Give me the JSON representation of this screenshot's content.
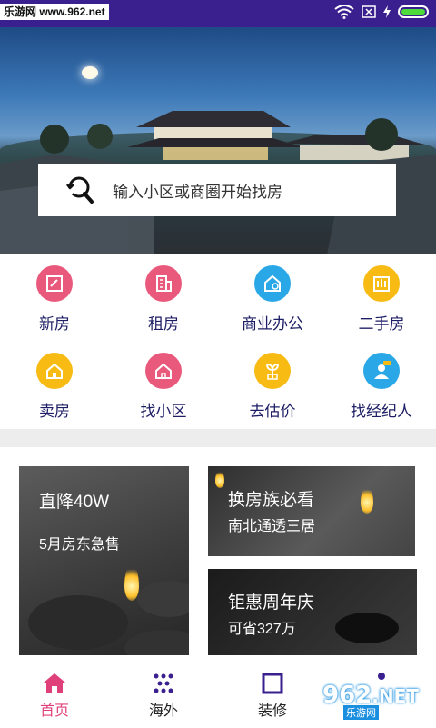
{
  "status_bar": {
    "watermark": "乐游网 www.962.net",
    "battery_level": 1.0
  },
  "search": {
    "placeholder": "输入小区或商圈开始找房",
    "icon": "search-back-icon"
  },
  "categories": [
    {
      "label": "新房",
      "icon": "new-house-icon",
      "color": "#e9597c"
    },
    {
      "label": "租房",
      "icon": "rent-building-icon",
      "color": "#e9597c"
    },
    {
      "label": "商业办公",
      "icon": "office-icon",
      "color": "#2aa7e6"
    },
    {
      "label": "二手房",
      "icon": "second-hand-icon",
      "color": "#f7bb14"
    },
    {
      "label": "卖房",
      "icon": "sell-house-icon",
      "color": "#f7bb14"
    },
    {
      "label": "找小区",
      "icon": "community-icon",
      "color": "#e9597c"
    },
    {
      "label": "去估价",
      "icon": "valuation-icon",
      "color": "#f7bb14"
    },
    {
      "label": "找经纪人",
      "icon": "agent-icon",
      "color": "#2aa7e6"
    }
  ],
  "promos": [
    {
      "title": "直降40W",
      "subtitle": "5月房东急售"
    },
    {
      "title": "换房族必看",
      "subtitle": "南北通透三居"
    },
    {
      "title": "钜惠周年庆",
      "subtitle": "可省327万"
    }
  ],
  "bottom_nav": [
    {
      "label": "首页",
      "icon": "home-icon",
      "active": true
    },
    {
      "label": "海外",
      "icon": "dots-grid-icon",
      "active": false
    },
    {
      "label": "装修",
      "icon": "square-icon",
      "active": false
    }
  ],
  "logo": {
    "text": "962",
    "suffix": ".NET",
    "sub": "乐游网"
  },
  "colors": {
    "accent": "#3a1f8f",
    "active_tab": "#e0407a",
    "label": "#1e1e66"
  }
}
